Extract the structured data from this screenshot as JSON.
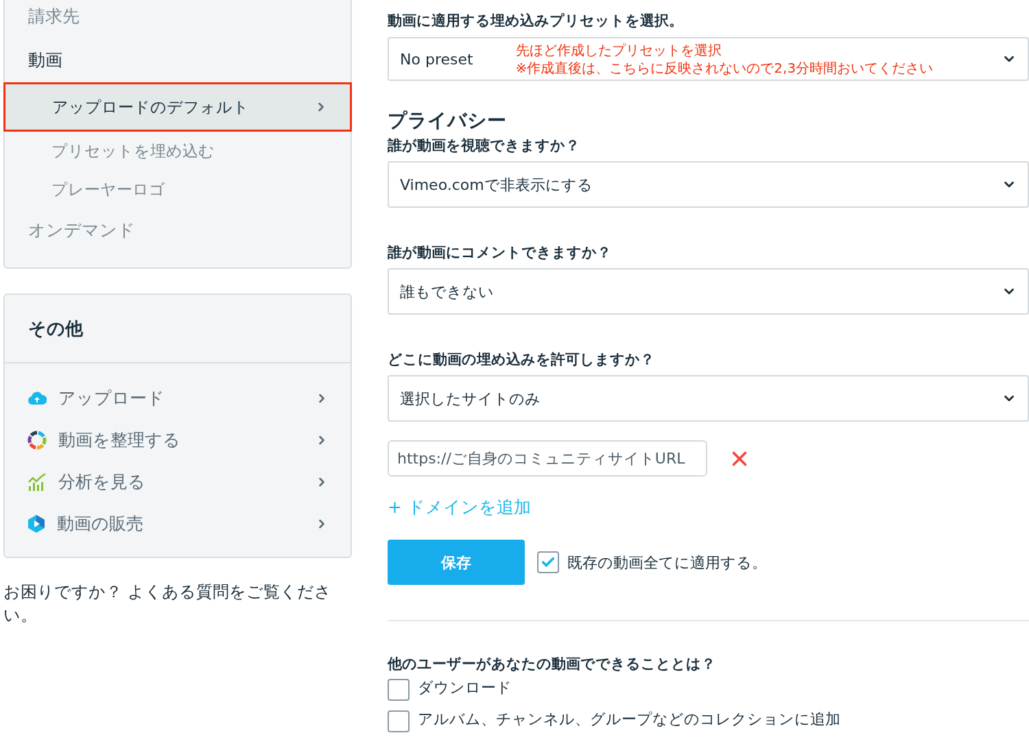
{
  "sidebar_menu": {
    "sections": [
      {
        "label": "請求先",
        "expanded": false
      },
      {
        "label": "動画",
        "expanded": true,
        "children": [
          {
            "label": "アップロードのデフォルト",
            "selected": true
          },
          {
            "label": "プリセットを埋め込む",
            "selected": false
          },
          {
            "label": "プレーヤーロゴ",
            "selected": false
          }
        ]
      },
      {
        "label": "オンデマンド",
        "expanded": false
      }
    ]
  },
  "other_panel": {
    "title": "その他",
    "items": [
      {
        "label": "アップロード"
      },
      {
        "label": "動画を整理する"
      },
      {
        "label": "分析を見る"
      },
      {
        "label": "動画の販売"
      }
    ]
  },
  "help_text": "お困りですか？ よくある質問をご覧ください。",
  "preset": {
    "label": "動画に適用する埋め込みプリセットを選択。",
    "value": "No preset",
    "annotation": [
      "先ほど作成したプリセットを選択",
      "※作成直後は、こちらに反映されないので2,3分時間おいてください"
    ]
  },
  "privacy": {
    "heading": "プライバシー",
    "fields": [
      {
        "label": "誰が動画を視聴できますか？",
        "value": "Vimeo.comで非表示にする"
      },
      {
        "label": "誰が動画にコメントできますか？",
        "value": "誰もできない"
      },
      {
        "label": "どこに動画の埋め込みを許可しますか？",
        "value": "選択したサイトのみ"
      }
    ]
  },
  "domain_input": {
    "value": "https://ご自身のコミュニティサイトURL"
  },
  "add_domain_link": "+ ドメインを追加",
  "save_button": "保存",
  "apply_all": {
    "label": "既存の動画全てに適用する。",
    "checked": true
  },
  "permissions": {
    "label": "他のユーザーがあなたの動画でできることとは？",
    "options": [
      {
        "label": "ダウンロード",
        "checked": false
      },
      {
        "label": "アルバム、チャンネル、グループなどのコレクションに追加",
        "checked": false
      }
    ]
  }
}
